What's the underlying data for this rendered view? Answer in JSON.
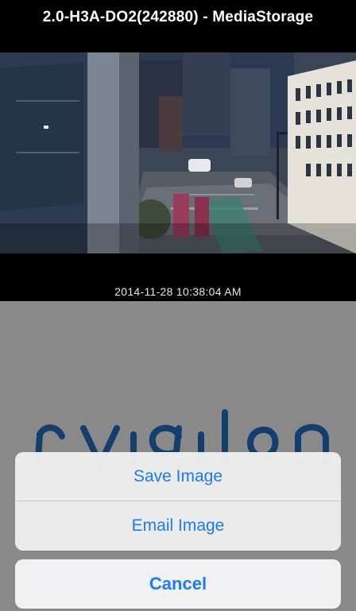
{
  "header": {
    "title": "2.0-H3A-DO2(242880) - MediaStorage"
  },
  "camera": {
    "timestamp": "2014-11-28 10:38:04 AM"
  },
  "action_sheet": {
    "save_label": "Save Image",
    "email_label": "Email Image",
    "cancel_label": "Cancel",
    "accent_color": "#1a7cf6"
  },
  "colors": {
    "background": "#000000",
    "backdrop": "#898989",
    "logo": "#123f6e"
  },
  "logo": {
    "text": "avigilon"
  }
}
